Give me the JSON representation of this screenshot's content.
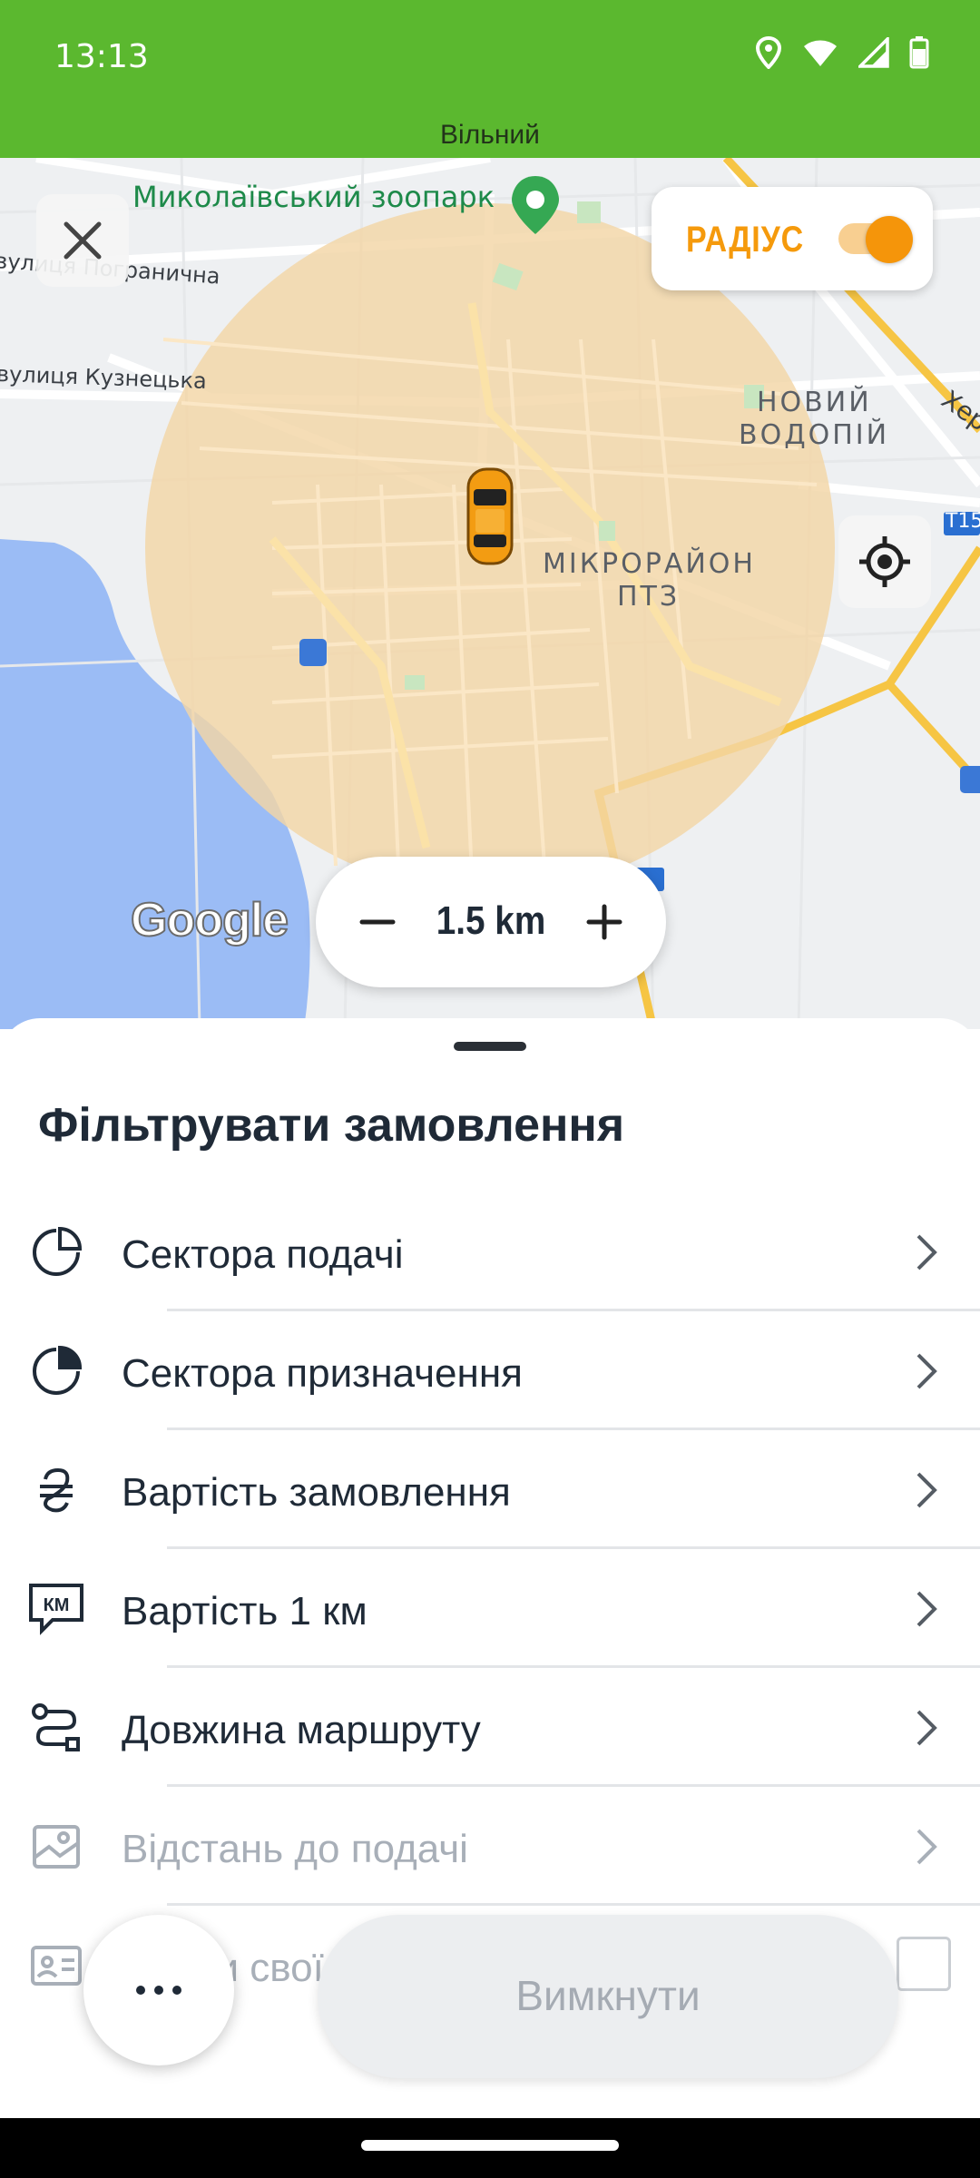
{
  "status_bar": {
    "time": "13:13",
    "icons": [
      "location-icon",
      "wifi-icon",
      "signal-icon",
      "battery-icon"
    ]
  },
  "driver_state": "Вільний",
  "map": {
    "labels": {
      "zoo": "Миколаївський зоопарк",
      "street_1": "вулиця Погранична",
      "street_2": "вулиця Кузнецька",
      "district_1_line1": "НОВИЙ",
      "district_1_line2": "ВОДОПІЙ",
      "district_2_line1": "МІКРОРАЙОН",
      "district_2_line2": "ПТЗ",
      "road_badge": "Т15",
      "highway_label": "Хер",
      "google": "Google"
    },
    "radius_toggle": {
      "label": "РАДІУС",
      "enabled": true
    },
    "zoom": {
      "value": "1.5 km"
    },
    "colors": {
      "radius_circle": "#f3d5a6",
      "water": "#9bbcf5",
      "accent": "#f5950a"
    }
  },
  "sheet": {
    "title": "Фільтрувати замовлення",
    "filters": [
      {
        "label": "Сектора подачі",
        "icon": "pie-sector-icon",
        "enabled": true
      },
      {
        "label": "Сектора призначення",
        "icon": "pie-filled-icon",
        "enabled": true
      },
      {
        "label": "Вартість замовлення",
        "icon": "hryvnia-icon",
        "enabled": true
      },
      {
        "label": "Вартість 1 км",
        "icon": "km-bubble-icon",
        "enabled": true
      },
      {
        "label": "Довжина маршруту",
        "icon": "route-icon",
        "enabled": true
      },
      {
        "label": "Відстань до подачі",
        "icon": "map-pin-photo-icon",
        "enabled": false
      },
      {
        "label": "Тільки свої",
        "icon": "id-card-icon",
        "enabled": false,
        "checkbox": false
      }
    ]
  },
  "actions": {
    "more_label": "⋯",
    "off_label": "Вимкнути"
  }
}
